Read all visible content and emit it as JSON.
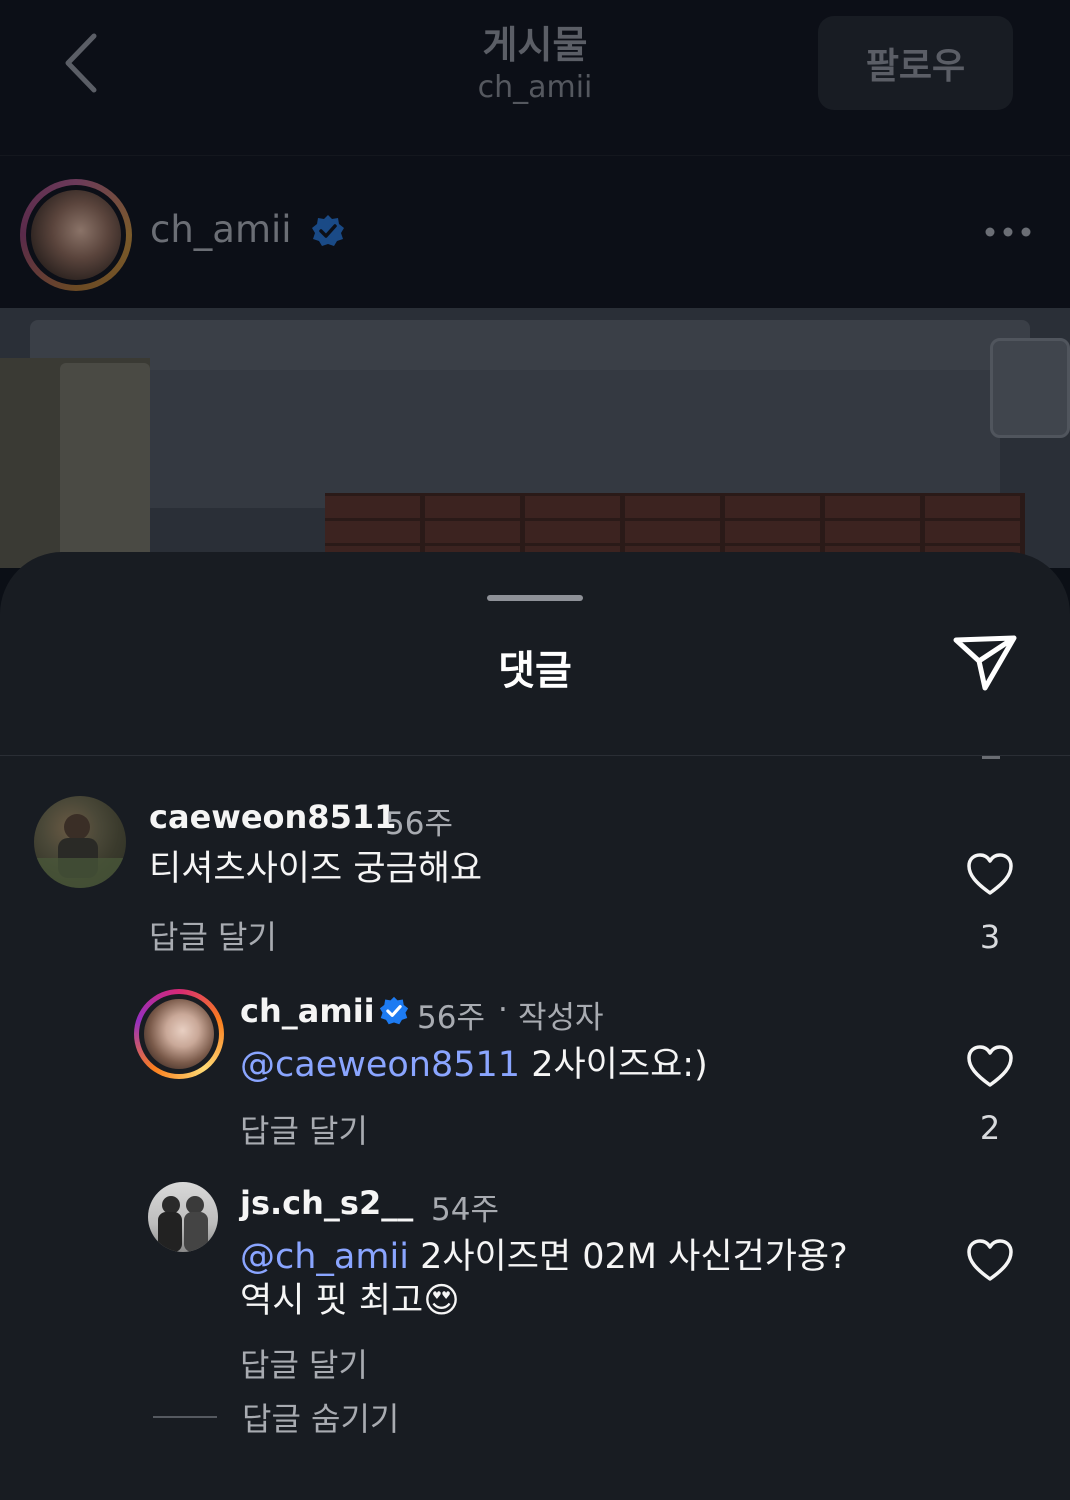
{
  "header": {
    "title": "게시물",
    "subtitle": "ch_amii",
    "follow_label": "팔로우"
  },
  "author": {
    "username": "ch_amii"
  },
  "sheet": {
    "title": "댓글"
  },
  "comments": [
    {
      "username": "caeweon8511",
      "time": "56주",
      "text": "티셔츠사이즈 궁금해요",
      "reply_label": "답글 달기",
      "likes": "3"
    },
    {
      "username": "ch_amii",
      "time": "56주",
      "separator": "·",
      "author_tag": "작성자",
      "mention": "@caeweon8511",
      "text": "2사이즈요:)",
      "reply_label": "답글 달기",
      "likes": "2"
    },
    {
      "username": "js.ch_s2__",
      "time": "54주",
      "mention": "@ch_amii",
      "text_line1": "2사이즈면 02M 사신건가용?",
      "text_line2": "역시 핏 최고",
      "emoji": "😍",
      "reply_label": "답글 달기"
    }
  ],
  "hide_replies_label": "답글 숨기기",
  "colors": {
    "background": "#0b0f16",
    "sheet": "#181c22",
    "mention": "#8aa5ff",
    "verified": "#1d7bf2"
  },
  "icons": [
    "back-arrow-icon",
    "verified-badge-icon",
    "more-options-icon",
    "share-icon",
    "heart-icon"
  ]
}
